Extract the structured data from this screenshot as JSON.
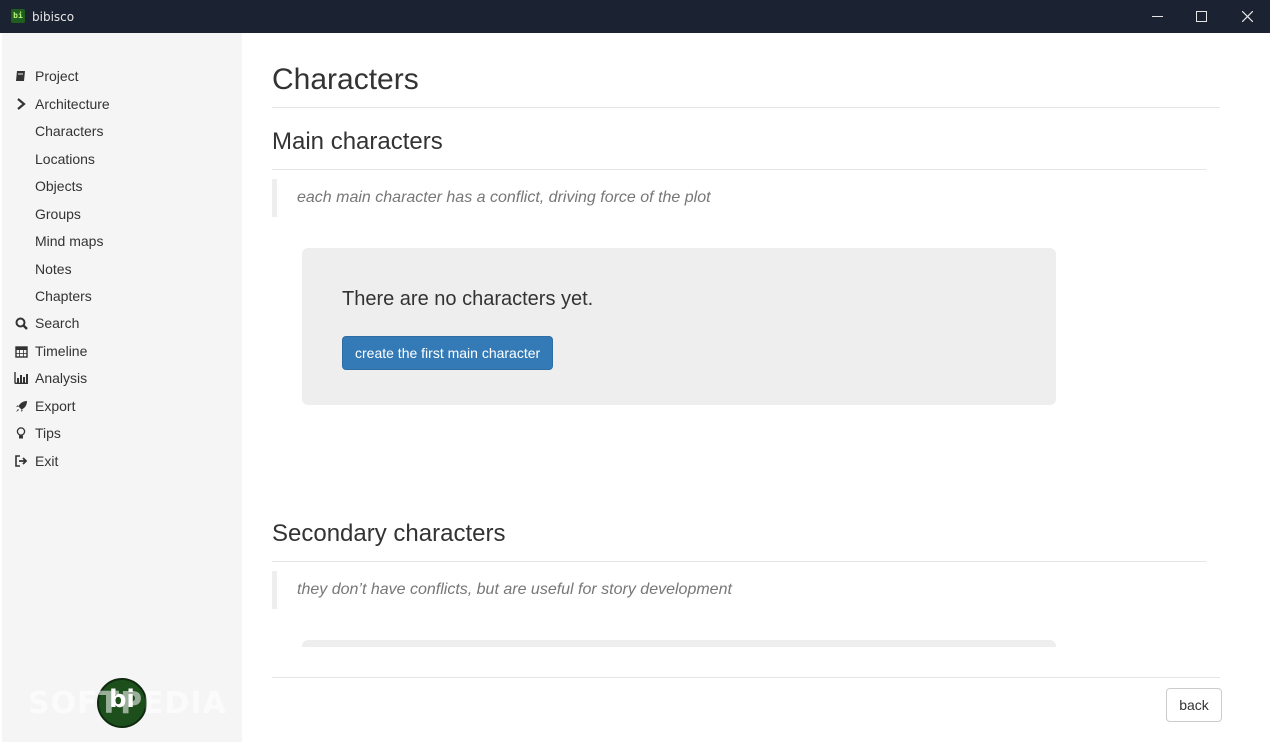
{
  "window": {
    "title": "bibisco",
    "app_icon_text": "bi"
  },
  "sidebar": {
    "items": [
      {
        "label": "Project",
        "icon": "book-icon"
      },
      {
        "label": "Architecture",
        "icon": "chevron-right-icon"
      },
      {
        "label": "Characters",
        "icon": ""
      },
      {
        "label": "Locations",
        "icon": ""
      },
      {
        "label": "Objects",
        "icon": ""
      },
      {
        "label": "Groups",
        "icon": ""
      },
      {
        "label": "Mind maps",
        "icon": ""
      },
      {
        "label": "Notes",
        "icon": ""
      },
      {
        "label": "Chapters",
        "icon": ""
      },
      {
        "label": "Search",
        "icon": "search-icon"
      },
      {
        "label": "Timeline",
        "icon": "calendar-icon"
      },
      {
        "label": "Analysis",
        "icon": "bar-chart-icon"
      },
      {
        "label": "Export",
        "icon": "rocket-icon"
      },
      {
        "label": "Tips",
        "icon": "lightbulb-icon"
      },
      {
        "label": "Exit",
        "icon": "sign-out-icon"
      }
    ],
    "logo_text": "bi"
  },
  "main": {
    "title": "Characters",
    "main_section": {
      "title": "Main characters",
      "quote": "each main character has a conflict, driving force of the plot",
      "empty_text": "There are no characters yet.",
      "create_button": "create the first main character"
    },
    "secondary_section": {
      "title": "Secondary characters",
      "quote": "they don’t have conflicts, but are useful for story development"
    },
    "back_button": "back"
  },
  "watermark": "SOFTPEDIA",
  "colors": {
    "titlebar": "#1b2333",
    "sidebar_bg": "#f5f5f5",
    "primary_button": "#337ab7",
    "jumbotron": "#eeeeee"
  }
}
